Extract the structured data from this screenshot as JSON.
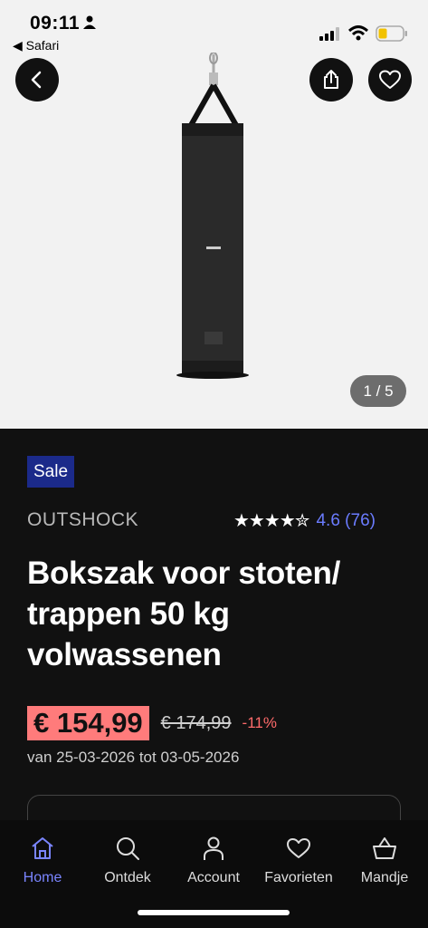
{
  "status_bar": {
    "time": "09:11",
    "back_app": "◀ Safari"
  },
  "gallery": {
    "counter": "1 / 5"
  },
  "product": {
    "badge": "Sale",
    "brand": "OUTSHOCK",
    "stars": "★★★★✮",
    "rating": "4.6 (76)",
    "title": "Bokszak voor stoten/ trappen 50 kg volwassenen",
    "price": "€ 154,99",
    "old_price": "€ 174,99",
    "discount": "-11%",
    "date_range": "van 25-03-2026 tot 03-05-2026"
  },
  "tabbar": {
    "items": [
      {
        "label": "Home",
        "icon": "home-icon",
        "active": true
      },
      {
        "label": "Ontdek",
        "icon": "search-icon"
      },
      {
        "label": "Account",
        "icon": "person-icon"
      },
      {
        "label": "Favorieten",
        "icon": "heart-icon"
      },
      {
        "label": "Mandje",
        "icon": "basket-icon"
      }
    ]
  },
  "colors": {
    "accent": "#7a85ff",
    "sale_badge": "#1b2a8a",
    "price_bg": "#ff7b7b",
    "discount": "#ff6b6b"
  }
}
